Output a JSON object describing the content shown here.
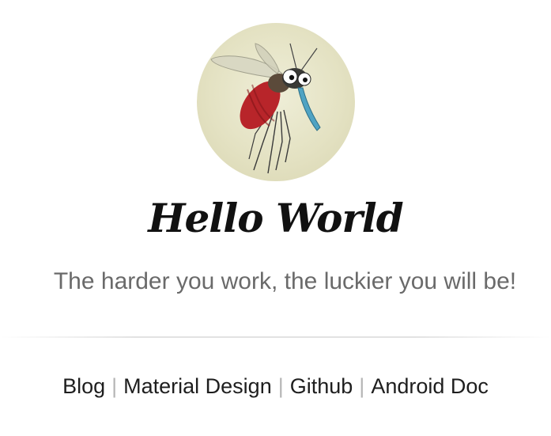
{
  "profile": {
    "avatar_icon": "mosquito-avatar-icon",
    "title": "Hello World",
    "motto": "The harder you work, the luckier you will be!"
  },
  "nav": {
    "separator": "|",
    "links": [
      {
        "label": "Blog"
      },
      {
        "label": "Material Design"
      },
      {
        "label": "Github"
      },
      {
        "label": "Android Doc"
      }
    ]
  },
  "colors": {
    "title": "#111111",
    "motto": "#6a6a6a",
    "link": "#1e1e1e",
    "separator": "#b5b5b5",
    "avatar_background": "#e4e2c3"
  }
}
